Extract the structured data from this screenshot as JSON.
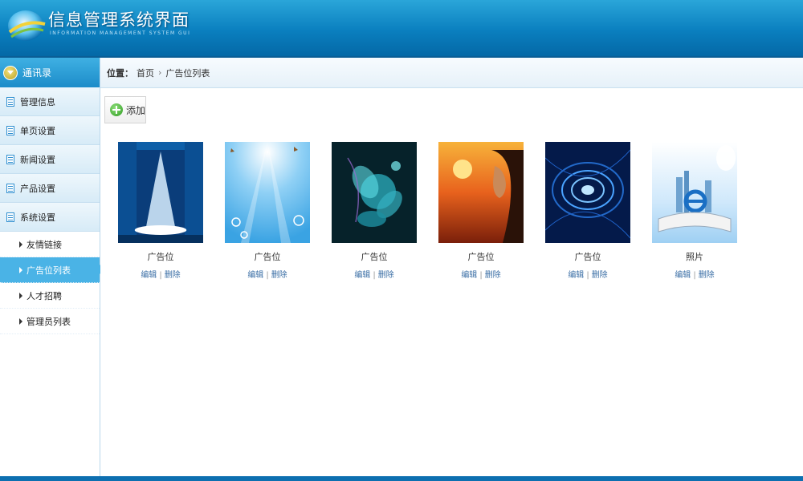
{
  "header": {
    "title": "信息管理系统界面",
    "subtitle": "INFORMATION MANAGEMENT SYSTEM GUI"
  },
  "sidebar": {
    "head_label": "通讯录",
    "groups": [
      {
        "label": "管理信息"
      },
      {
        "label": "单页设置"
      },
      {
        "label": "新闻设置"
      },
      {
        "label": "产品设置"
      },
      {
        "label": "系统设置"
      }
    ],
    "sub_items": [
      {
        "label": "友情链接",
        "active": false
      },
      {
        "label": "广告位列表",
        "active": true
      },
      {
        "label": "人才招聘",
        "active": false
      },
      {
        "label": "管理员列表",
        "active": false
      }
    ]
  },
  "breadcrumb": {
    "label": "位置：",
    "items": [
      "首页",
      "广告位列表"
    ],
    "separator": "›"
  },
  "toolbar": {
    "add_label": "添加"
  },
  "cards": [
    {
      "title": "广告位",
      "edit": "编辑",
      "delete": "删除",
      "image": "stage-spotlight"
    },
    {
      "title": "广告位",
      "edit": "编辑",
      "delete": "删除",
      "image": "light-rays-butterflies"
    },
    {
      "title": "广告位",
      "edit": "编辑",
      "delete": "删除",
      "image": "glowing-flower"
    },
    {
      "title": "广告位",
      "edit": "编辑",
      "delete": "删除",
      "image": "sunset-woman"
    },
    {
      "title": "广告位",
      "edit": "编辑",
      "delete": "删除",
      "image": "blue-tech-circles"
    },
    {
      "title": "照片",
      "edit": "编辑",
      "delete": "删除",
      "image": "ie-book-city"
    }
  ],
  "colors": {
    "header_blue": "#0a7fbf",
    "active_item": "#4ab3e6",
    "link": "#3a6ea5"
  }
}
